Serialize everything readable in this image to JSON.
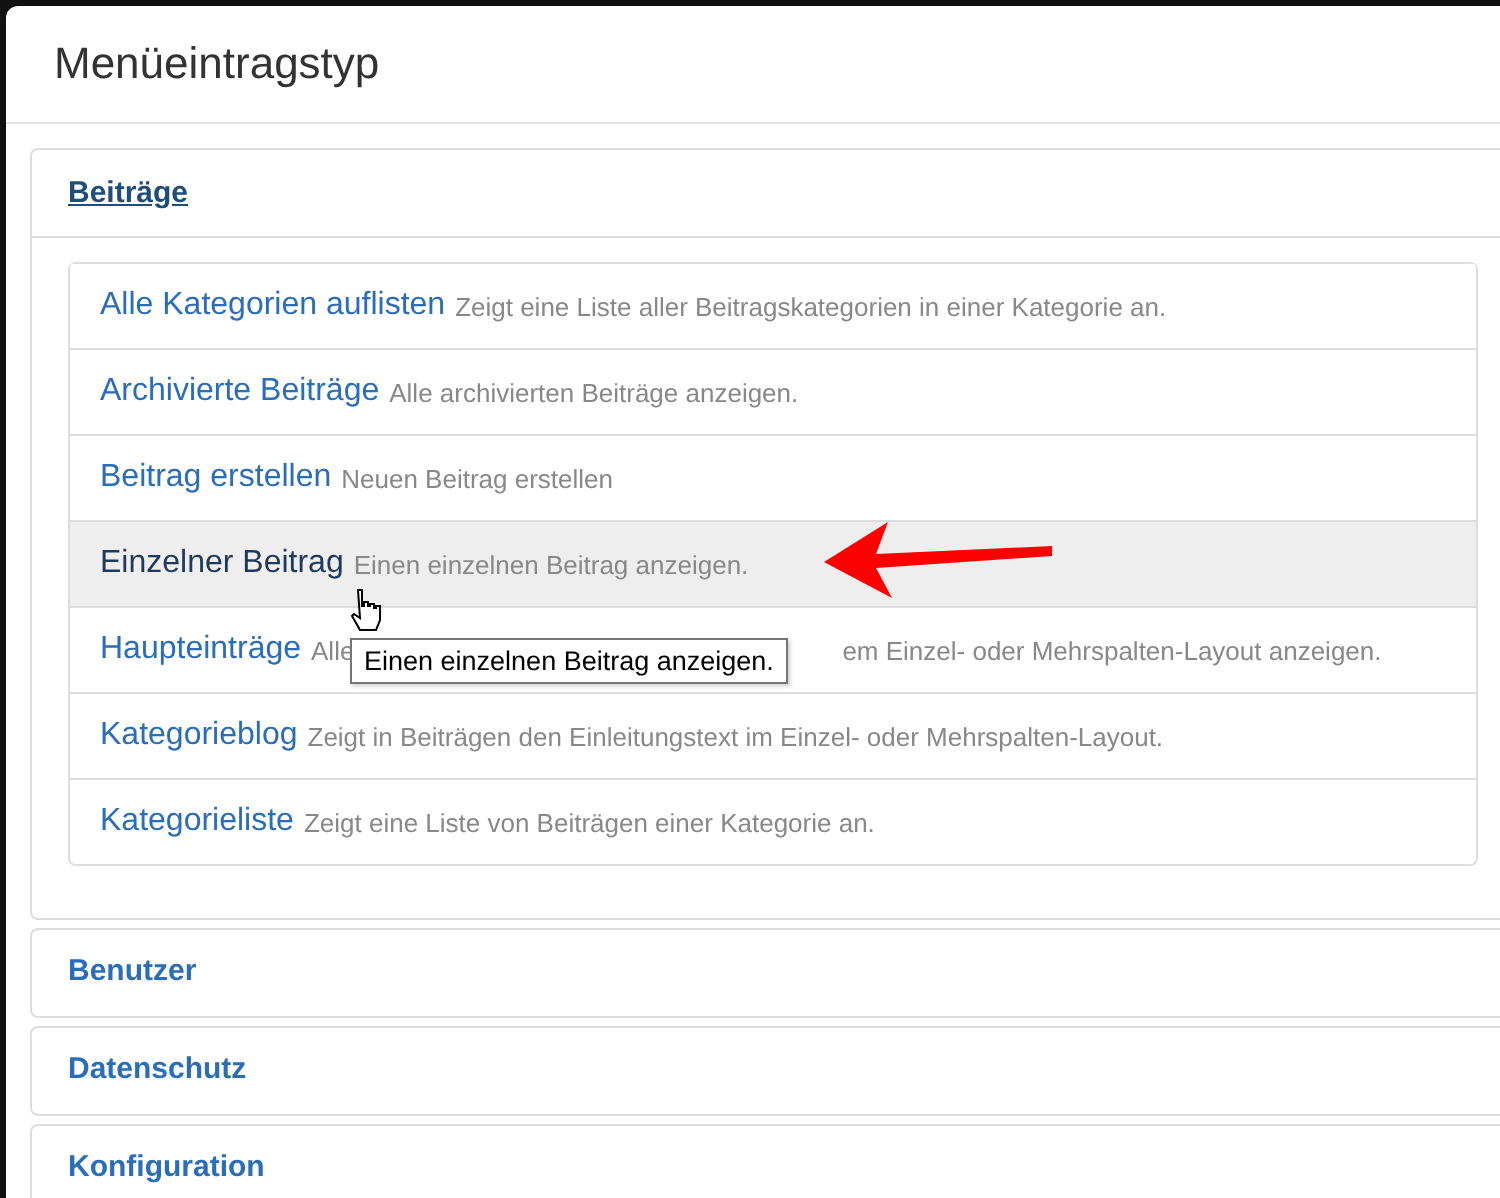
{
  "window": {
    "title": "Menüeintragstyp"
  },
  "groups": [
    {
      "title": "Beiträge",
      "expanded": true,
      "items": [
        {
          "label": "Alle Kategorien auflisten",
          "description": "Zeigt eine Liste aller Beitragskategorien in einer Kategorie an.",
          "selected": false
        },
        {
          "label": "Archivierte Beiträge",
          "description": "Alle archivierten Beiträge anzeigen.",
          "selected": false
        },
        {
          "label": "Beitrag erstellen",
          "description": "Neuen Beitrag erstellen",
          "selected": false
        },
        {
          "label": "Einzelner Beitrag",
          "description": "Einen einzelnen Beitrag anzeigen.",
          "selected": true
        },
        {
          "label": "Haupteinträge",
          "description": "Alle",
          "description_end": "em Einzel- oder Mehrspalten-Layout anzeigen.",
          "selected": false
        },
        {
          "label": "Kategorieblog",
          "description": "Zeigt in Beiträgen den Einleitungstext im Einzel- oder Mehrspalten-Layout.",
          "selected": false
        },
        {
          "label": "Kategorieliste",
          "description": "Zeigt eine Liste von Beiträgen einer Kategorie an.",
          "selected": false
        }
      ]
    },
    {
      "title": "Benutzer",
      "expanded": false
    },
    {
      "title": "Datenschutz",
      "expanded": false
    },
    {
      "title": "Konfiguration",
      "expanded": false
    }
  ],
  "tooltip": {
    "text": "Einen einzelnen Beitrag anzeigen."
  }
}
